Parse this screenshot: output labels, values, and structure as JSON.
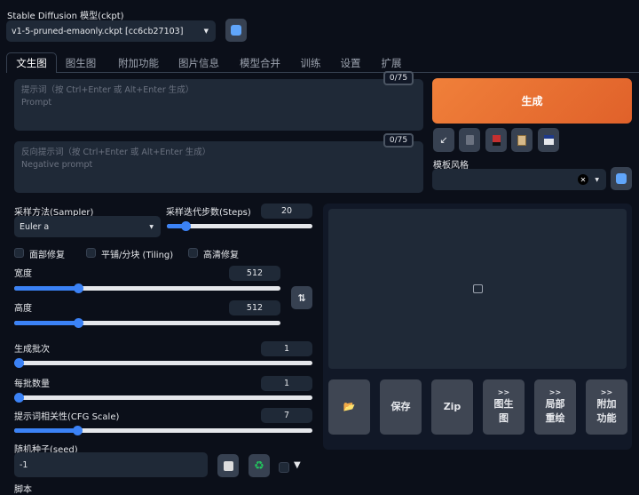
{
  "model": {
    "label": "Stable Diffusion 模型(ckpt)",
    "value": "v1-5-pruned-emaonly.ckpt [cc6cb27103]"
  },
  "tabs": [
    "文生图",
    "图生图",
    "附加功能",
    "图片信息",
    "模型合并",
    "训练",
    "设置",
    "扩展"
  ],
  "prompt": {
    "placeholder_line1": "提示词（按 Ctrl+Enter 或 Alt+Enter 生成）",
    "placeholder_line2": "Prompt",
    "counter": "0/75"
  },
  "negative_prompt": {
    "placeholder_line1": "反向提示词（按 Ctrl+Enter 或 Alt+Enter 生成）",
    "placeholder_line2": "Negative prompt",
    "counter": "0/75"
  },
  "generate_label": "生成",
  "style": {
    "label": "模板风格",
    "value": ""
  },
  "sampler": {
    "label": "采样方法(Sampler)",
    "value": "Euler a"
  },
  "steps": {
    "label": "采样迭代步数(Steps)",
    "value": "20",
    "fraction": 0.13
  },
  "checkboxes": [
    "面部修复",
    "平铺/分块 (Tiling)",
    "高清修复"
  ],
  "width": {
    "label": "宽度",
    "value": "512",
    "fraction": 0.24
  },
  "height": {
    "label": "高度",
    "value": "512",
    "fraction": 0.24
  },
  "batch_count": {
    "label": "生成批次",
    "value": "1",
    "fraction": 0
  },
  "batch_size": {
    "label": "每批数量",
    "value": "1",
    "fraction": 0
  },
  "cfg": {
    "label": "提示词相关性(CFG Scale)",
    "value": "7",
    "fraction": 0.21
  },
  "seed": {
    "label": "随机种子(seed)",
    "value": "-1",
    "extra_toggle": "▼"
  },
  "script_label": "脚本",
  "output_buttons": [
    {
      "arrow": "",
      "label": "📂"
    },
    {
      "arrow": "",
      "label": "保存"
    },
    {
      "arrow": "",
      "label": "Zip"
    },
    {
      "arrow": ">>",
      "label": "图生图"
    },
    {
      "arrow": ">>",
      "label": "局部重绘"
    },
    {
      "arrow": ">>",
      "label": "附加功能"
    }
  ],
  "colors": {
    "accent": "#3b82f6",
    "generate": "#ea6a2a",
    "bg": "#0b0f19"
  }
}
